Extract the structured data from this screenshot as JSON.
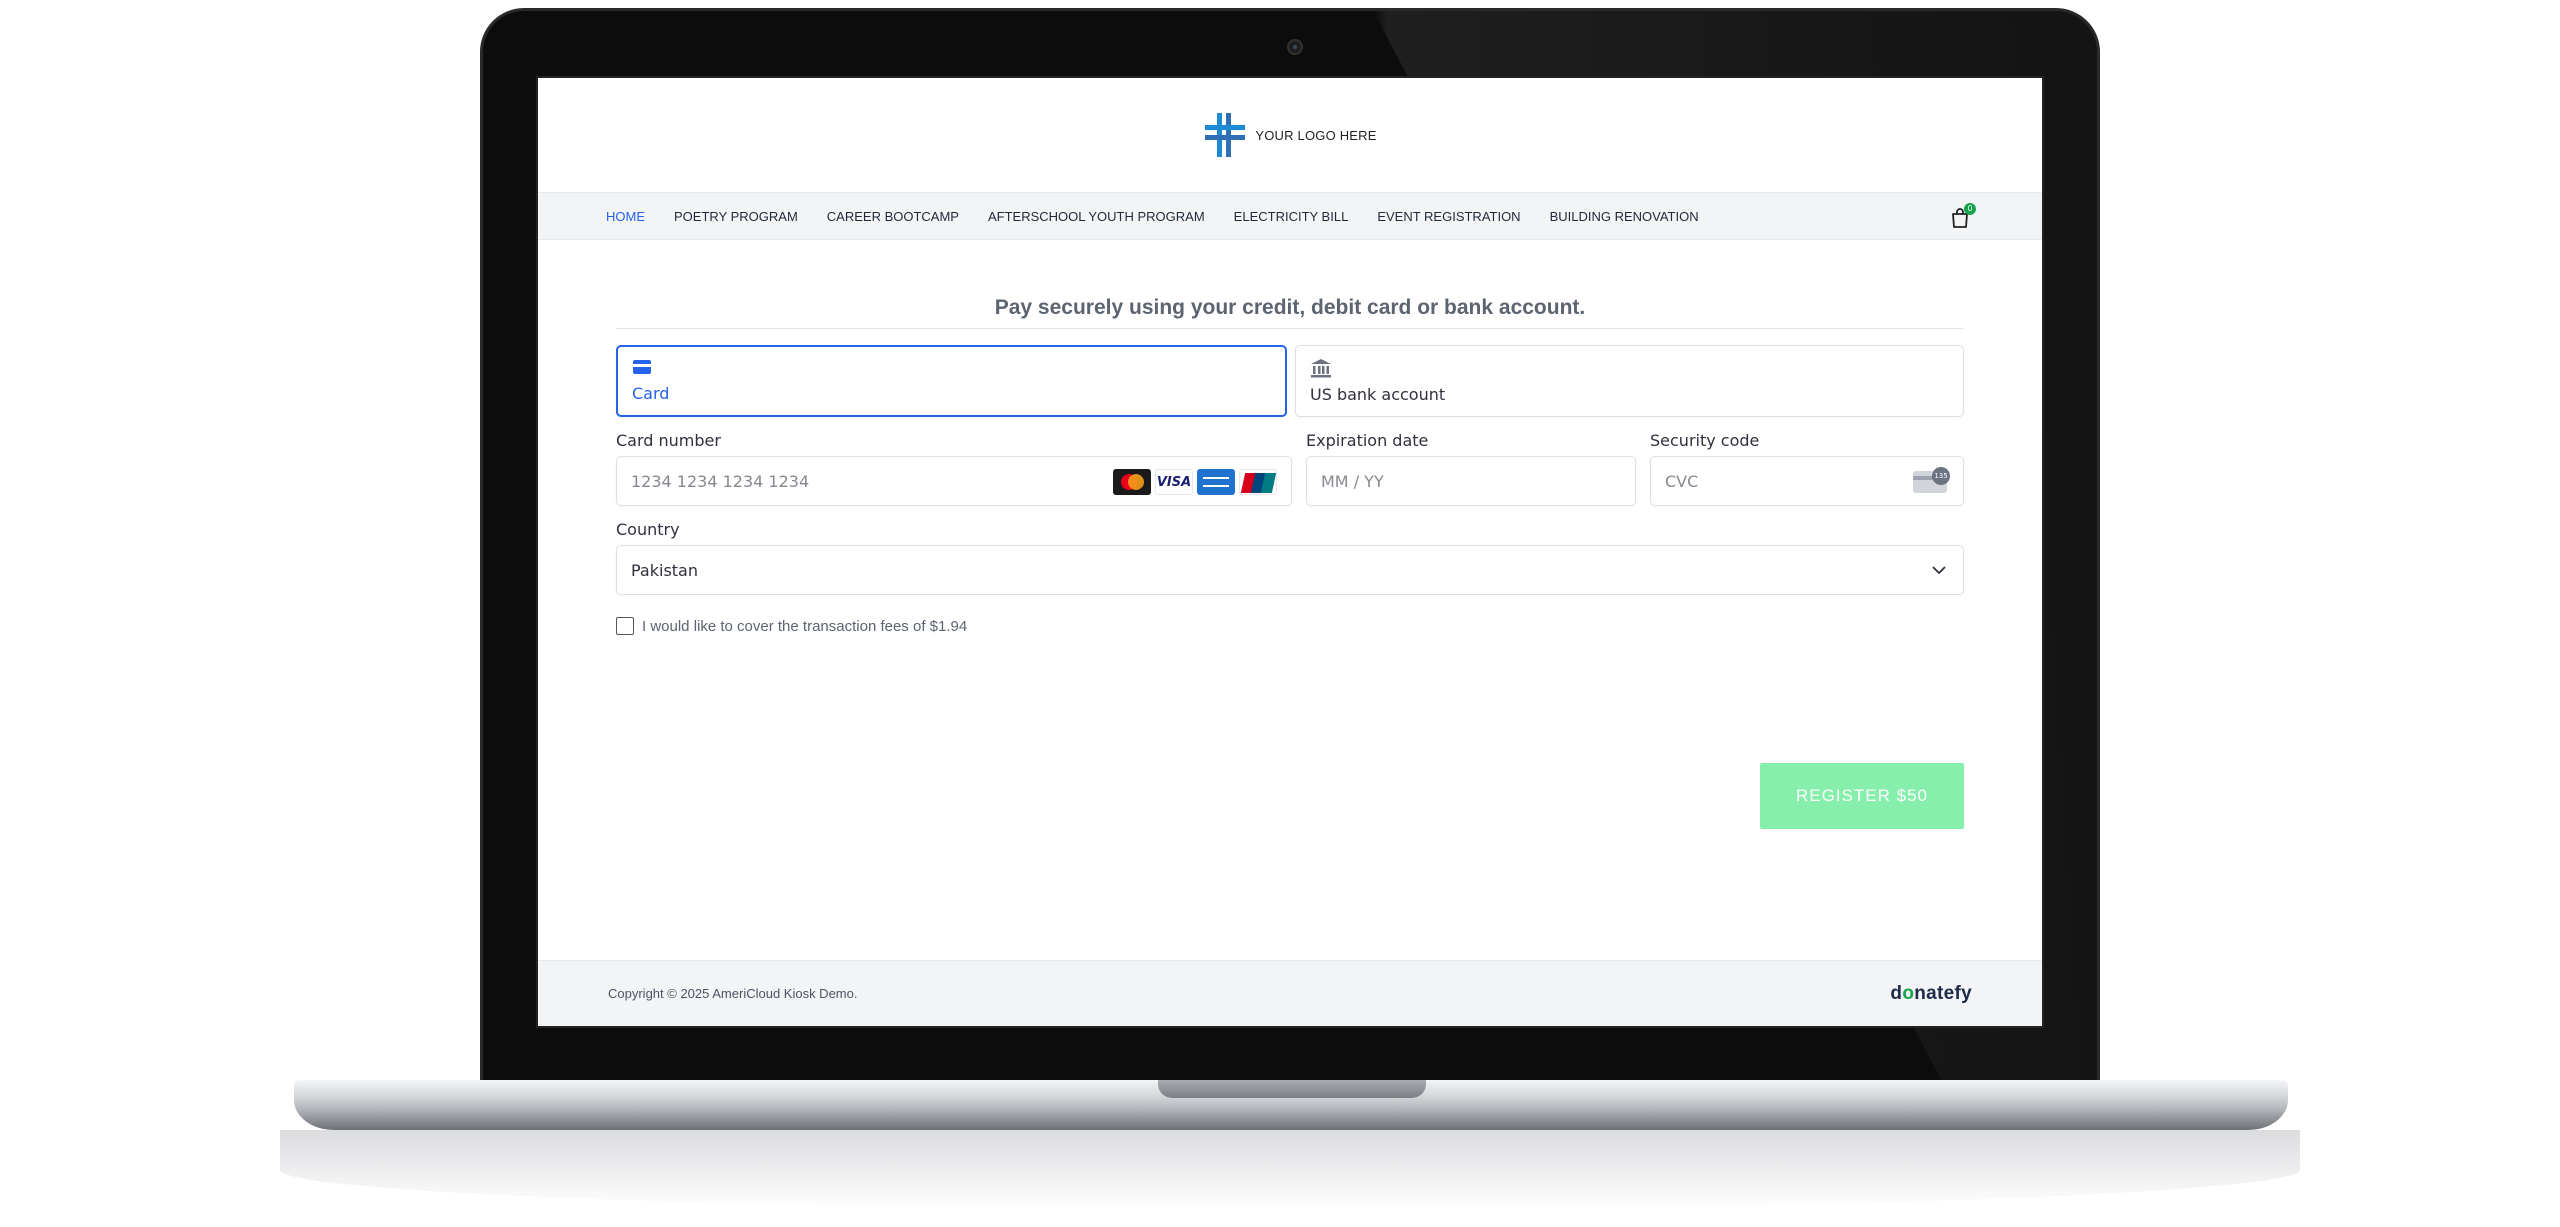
{
  "header": {
    "logo_text": "YOUR LOGO HERE"
  },
  "nav": {
    "items": [
      {
        "label": "HOME",
        "active": true
      },
      {
        "label": "POETRY PROGRAM"
      },
      {
        "label": "CAREER BOOTCAMP"
      },
      {
        "label": "AFTERSCHOOL YOUTH PROGRAM"
      },
      {
        "label": "ELECTRICITY BILL"
      },
      {
        "label": "EVENT REGISTRATION"
      },
      {
        "label": "BUILDING RENOVATION"
      }
    ],
    "cart_count": "0"
  },
  "payment": {
    "title": "Pay securely using your credit, debit card or bank account.",
    "tabs": [
      {
        "label": "Card",
        "icon": "credit-card-icon",
        "selected": true
      },
      {
        "label": "US bank account",
        "icon": "bank-icon"
      }
    ],
    "card_number": {
      "label": "Card number",
      "placeholder": "1234 1234 1234 1234"
    },
    "card_brands": [
      "mastercard",
      "visa",
      "amex",
      "unionpay"
    ],
    "visa_text": "VISA",
    "expiry": {
      "label": "Expiration date",
      "placeholder": "MM / YY"
    },
    "cvc": {
      "label": "Security code",
      "placeholder": "CVC",
      "icon_text": "135"
    },
    "country": {
      "label": "Country",
      "value": "Pakistan"
    },
    "fee_checkbox_label": "I would like to cover the transaction fees of $1.94",
    "register_label": "REGISTER $50"
  },
  "footer": {
    "copyright": "Copyright © 2025 AmeriCloud Kiosk Demo.",
    "brand_prefix": "d",
    "brand_o": "o",
    "brand_suffix": "natefy"
  },
  "colors": {
    "accent": "#2563eb",
    "register_button": "#86efac",
    "cart_badge": "#16a34a",
    "logo_blue": "#1d8ad6"
  }
}
